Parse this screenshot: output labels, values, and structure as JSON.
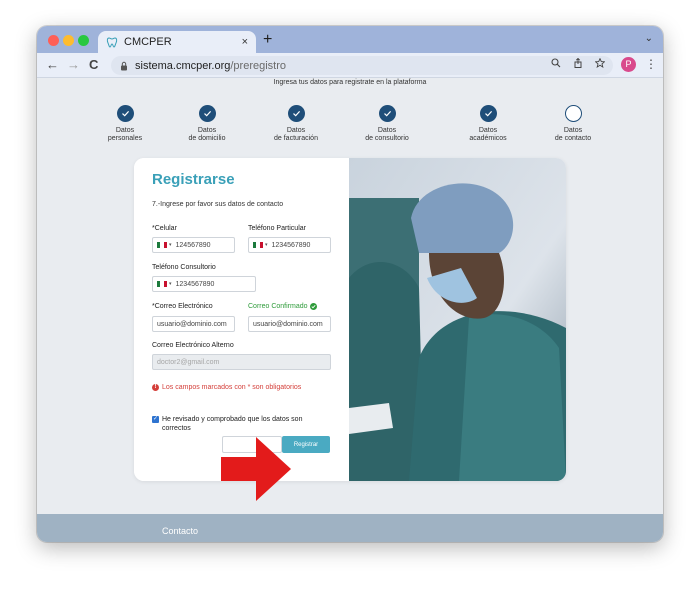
{
  "browser": {
    "tab_title": "CMCPER",
    "tab_close": "×",
    "new_tab": "+",
    "tab_dropdown": "⌄",
    "url_host": "sistema.cmcper.org",
    "url_path": "/preregistro",
    "profile_initial": "P",
    "nav_back": "←",
    "nav_forward": "→",
    "nav_reload": "C",
    "menu": "⋮"
  },
  "page": {
    "subtitle": "Ingresa tus datos para registrate en la plataforma",
    "steps": [
      {
        "line1": "Datos",
        "line2": "personales",
        "completed": true
      },
      {
        "line1": "Datos",
        "line2": "de domicilio",
        "completed": true
      },
      {
        "line1": "Datos",
        "line2": "de facturación",
        "completed": true
      },
      {
        "line1": "Datos",
        "line2": "de consultorio",
        "completed": true
      },
      {
        "line1": "Datos",
        "line2": "académicos",
        "completed": true
      },
      {
        "line1": "Datos",
        "line2": "de contacto",
        "completed": false
      }
    ]
  },
  "form": {
    "title": "Registrarse",
    "instruction": "7.-Ingrese por favor sus datos de contacto",
    "celular_label": "*Celular",
    "celular_value": "124567890",
    "telefono_particular_label": "Teléfono Particular",
    "telefono_particular_value": "1234567890",
    "telefono_consultorio_label": "Teléfono Consultorio",
    "telefono_consultorio_value": "1234567890",
    "correo_label": "*Correo Electrónico",
    "correo_value": "usuario@dominio.com",
    "correo_confirmado_label": "Correo Confirmado",
    "correo_confirmado_value": "usuario@dominio.com",
    "correo_alterno_label": "Correo Electrónico Alterno",
    "correo_alterno_placeholder": "doctor2@gmail.com",
    "required_note": "Los campos marcados con * son obligatorios",
    "checkbox_label": "He revisado y comprobado que los datos son correctos",
    "checkbox_checked": true,
    "submit_label": "Registrar",
    "flag_caret": "▾"
  },
  "footer": {
    "title": "Contacto"
  },
  "colors": {
    "accent": "#3aa0b8",
    "step_blue": "#1f4e79",
    "error_red": "#d43f3a",
    "success_green": "#2e9b3a",
    "arrow_red": "#e31b1b"
  }
}
